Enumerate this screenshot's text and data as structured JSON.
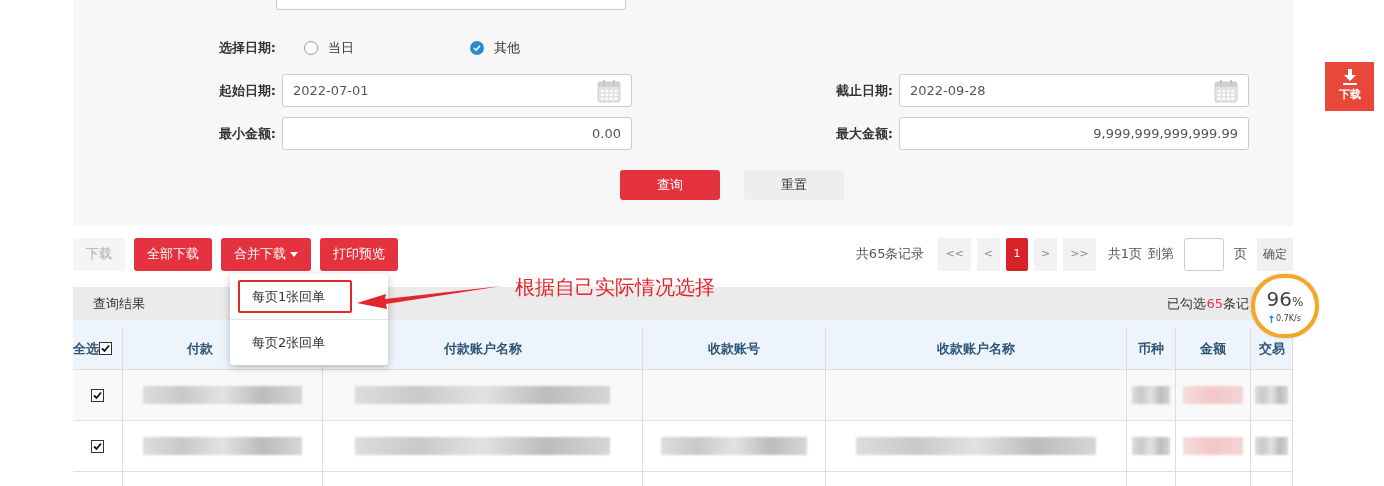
{
  "form": {
    "date_choice": {
      "label": "选择日期:",
      "options": [
        {
          "label": "当日",
          "selected": false
        },
        {
          "label": "其他",
          "selected": true
        }
      ]
    },
    "start_date": {
      "label": "起始日期:",
      "value": "2022-07-01"
    },
    "end_date": {
      "label": "截止日期:",
      "value": "2022-09-28"
    },
    "min_amount": {
      "label": "最小金额:",
      "value": "0.00"
    },
    "max_amount": {
      "label": "最大金额:",
      "value": "9,999,999,999,999.99"
    },
    "buttons": [
      {
        "label": "查询",
        "kind": "primary"
      },
      {
        "label": "重置",
        "kind": "secondary"
      }
    ]
  },
  "toolbar": {
    "buttons": [
      {
        "label": "下载",
        "disabled": true,
        "dropdown": false
      },
      {
        "label": "全部下载",
        "disabled": false,
        "dropdown": false
      },
      {
        "label": "合并下载",
        "disabled": false,
        "dropdown": true
      },
      {
        "label": "打印预览",
        "disabled": false,
        "dropdown": false
      }
    ]
  },
  "dropdown_menu": [
    {
      "label": "每页1张回单",
      "highlighted": true
    },
    {
      "label": "每页2张回单",
      "highlighted": false
    }
  ],
  "annotation": "根据自己实际情况选择",
  "pagination": {
    "total": "共65条记录",
    "pages": [
      {
        "label": "<<",
        "selected": false
      },
      {
        "label": "<",
        "selected": false
      },
      {
        "label": "1",
        "selected": true
      },
      {
        "label": ">",
        "selected": false
      },
      {
        "label": ">>",
        "selected": false
      }
    ],
    "page_count": "共1页",
    "goto": "到第",
    "page_unit": "页",
    "confirm": "确定"
  },
  "results": {
    "title": "查询结果",
    "selected_prefix": "已勾选",
    "selected_count": "65",
    "selected_suffix": "条记"
  },
  "table": {
    "select_all": {
      "label": "全选",
      "checked": true
    },
    "columns": [
      "付款",
      "付款账户名称",
      "收款账号",
      "收款账户名称",
      "币种",
      "金额",
      "交易"
    ],
    "rows": [
      {
        "checked": true,
        "cells": [
          {
            "kind": "blur"
          },
          {
            "kind": "blur"
          },
          {
            "kind": "empty"
          },
          {
            "kind": "empty"
          },
          {
            "kind": "blur"
          },
          {
            "kind": "blur-red"
          },
          {
            "kind": "blur"
          }
        ]
      },
      {
        "checked": true,
        "cells": [
          {
            "kind": "blur"
          },
          {
            "kind": "blur"
          },
          {
            "kind": "blur"
          },
          {
            "kind": "blur"
          },
          {
            "kind": "blur"
          },
          {
            "kind": "blur-red"
          },
          {
            "kind": "blur"
          }
        ]
      }
    ]
  },
  "speed_widget": {
    "percent": "96",
    "unit": "%",
    "rate": "0.7K/s"
  },
  "side_download": {
    "label": "下载"
  }
}
